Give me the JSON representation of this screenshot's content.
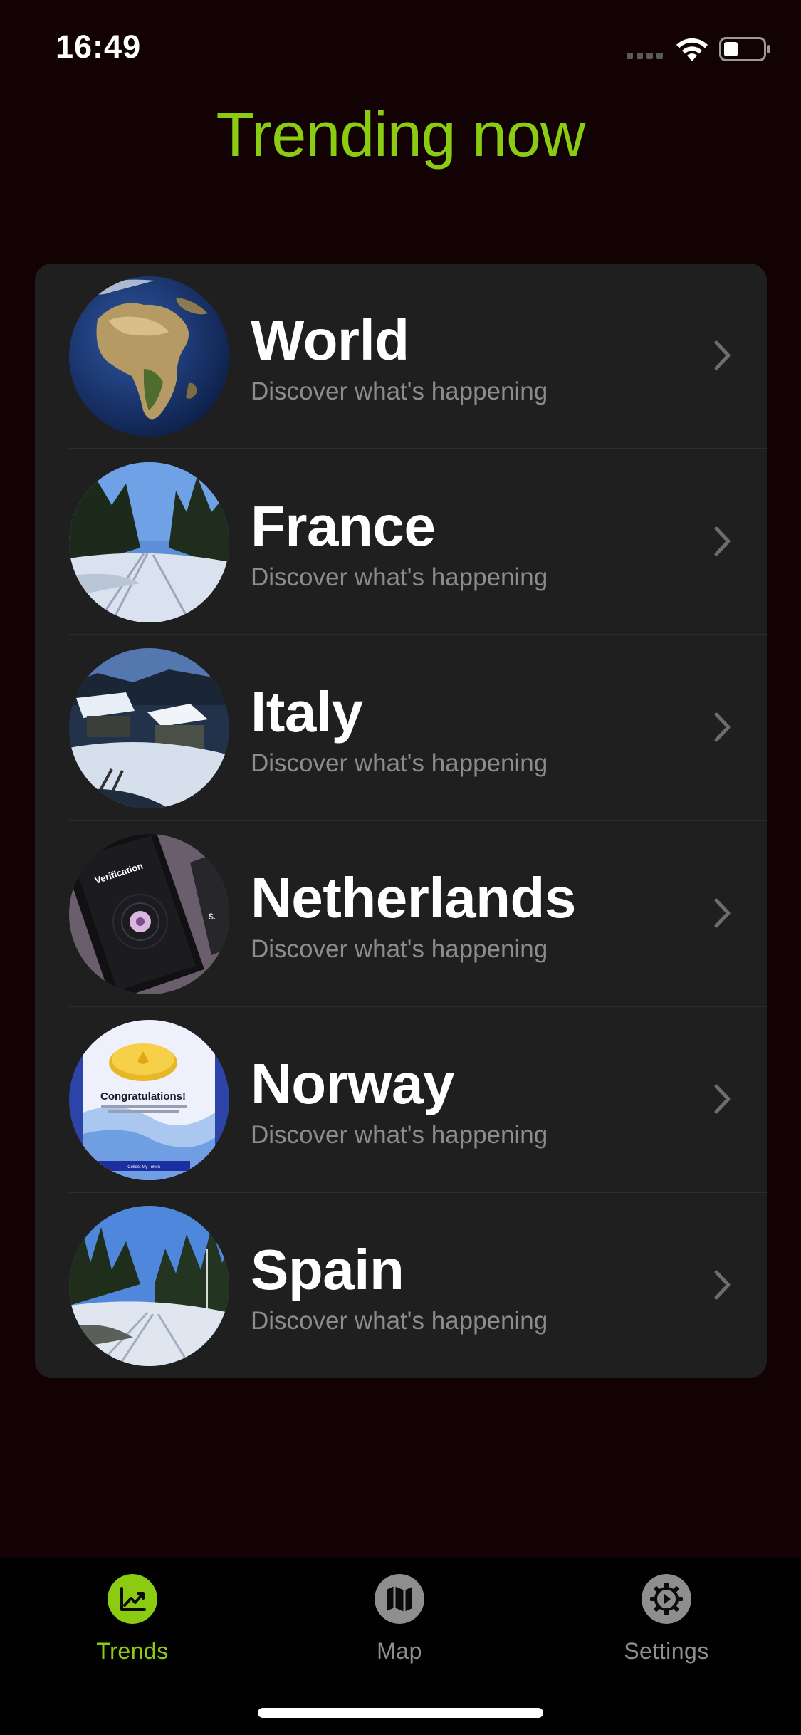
{
  "status_bar": {
    "time": "16:49"
  },
  "header": {
    "title": "Trending now"
  },
  "colors": {
    "accent": "#8bcc12",
    "background": "#130203",
    "card": "#1f1f1f",
    "subtitle": "#8c8c8c",
    "tab_inactive": "#8e8e8e"
  },
  "trends": [
    {
      "title": "World",
      "subtitle": "Discover what's happening",
      "thumbnail": "earth-globe-image"
    },
    {
      "title": "France",
      "subtitle": "Discover what's happening",
      "thumbnail": "snowy-forest-path-image"
    },
    {
      "title": "Italy",
      "subtitle": "Discover what's happening",
      "thumbnail": "snowy-cabins-image"
    },
    {
      "title": "Netherlands",
      "subtitle": "Discover what's happening",
      "thumbnail": "app-verification-screenshot-image"
    },
    {
      "title": "Norway",
      "subtitle": "Discover what's happening",
      "thumbnail": "app-congratulations-screenshot-image"
    },
    {
      "title": "Spain",
      "subtitle": "Discover what's happening",
      "thumbnail": "snowy-forest-trail-image"
    }
  ],
  "thumbnail_text": {
    "verification": "Verification",
    "congratulations": "Congratulations!",
    "collect": "Collect My Token"
  },
  "tab_bar": {
    "tabs": [
      {
        "label": "Trends",
        "icon": "chart-trend-icon",
        "selected": true
      },
      {
        "label": "Map",
        "icon": "map-icon",
        "selected": false
      },
      {
        "label": "Settings",
        "icon": "gear-icon",
        "selected": false
      }
    ]
  }
}
